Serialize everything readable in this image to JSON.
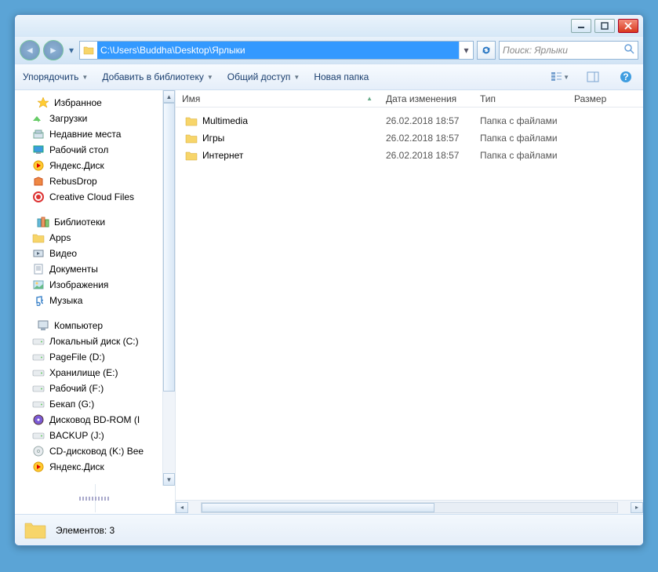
{
  "address": "C:\\Users\\Buddha\\Desktop\\Ярлыки",
  "search_placeholder": "Поиск: Ярлыки",
  "toolbar": {
    "organize": "Упорядочить",
    "add_lib": "Добавить в библиотеку",
    "share": "Общий доступ",
    "new_folder": "Новая папка"
  },
  "columns": {
    "name": "Имя",
    "date": "Дата изменения",
    "type": "Тип",
    "size": "Размер"
  },
  "files": [
    {
      "name": "Multimedia",
      "date": "26.02.2018 18:57",
      "type": "Папка с файлами"
    },
    {
      "name": "Игры",
      "date": "26.02.2018 18:57",
      "type": "Папка с файлами"
    },
    {
      "name": "Интернет",
      "date": "26.02.2018 18:57",
      "type": "Папка с файлами"
    }
  ],
  "sidebar": {
    "favorites": {
      "label": "Избранное",
      "items": [
        "Загрузки",
        "Недавние места",
        "Рабочий стол",
        "Яндекс.Диск",
        "RebusDrop",
        "Creative Cloud Files"
      ]
    },
    "libraries": {
      "label": "Библиотеки",
      "items": [
        "Apps",
        "Видео",
        "Документы",
        "Изображения",
        "Музыка"
      ]
    },
    "computer": {
      "label": "Компьютер",
      "items": [
        "Локальный диск (C:)",
        "PageFile (D:)",
        "Хранилище (E:)",
        "Рабочий (F:)",
        "Бекап (G:)",
        "Дисковод BD-ROM (I",
        "BACKUP (J:)",
        "CD-дисковод (K:) Bee",
        "Яндекс.Диск"
      ]
    }
  },
  "status": "Элементов: 3"
}
